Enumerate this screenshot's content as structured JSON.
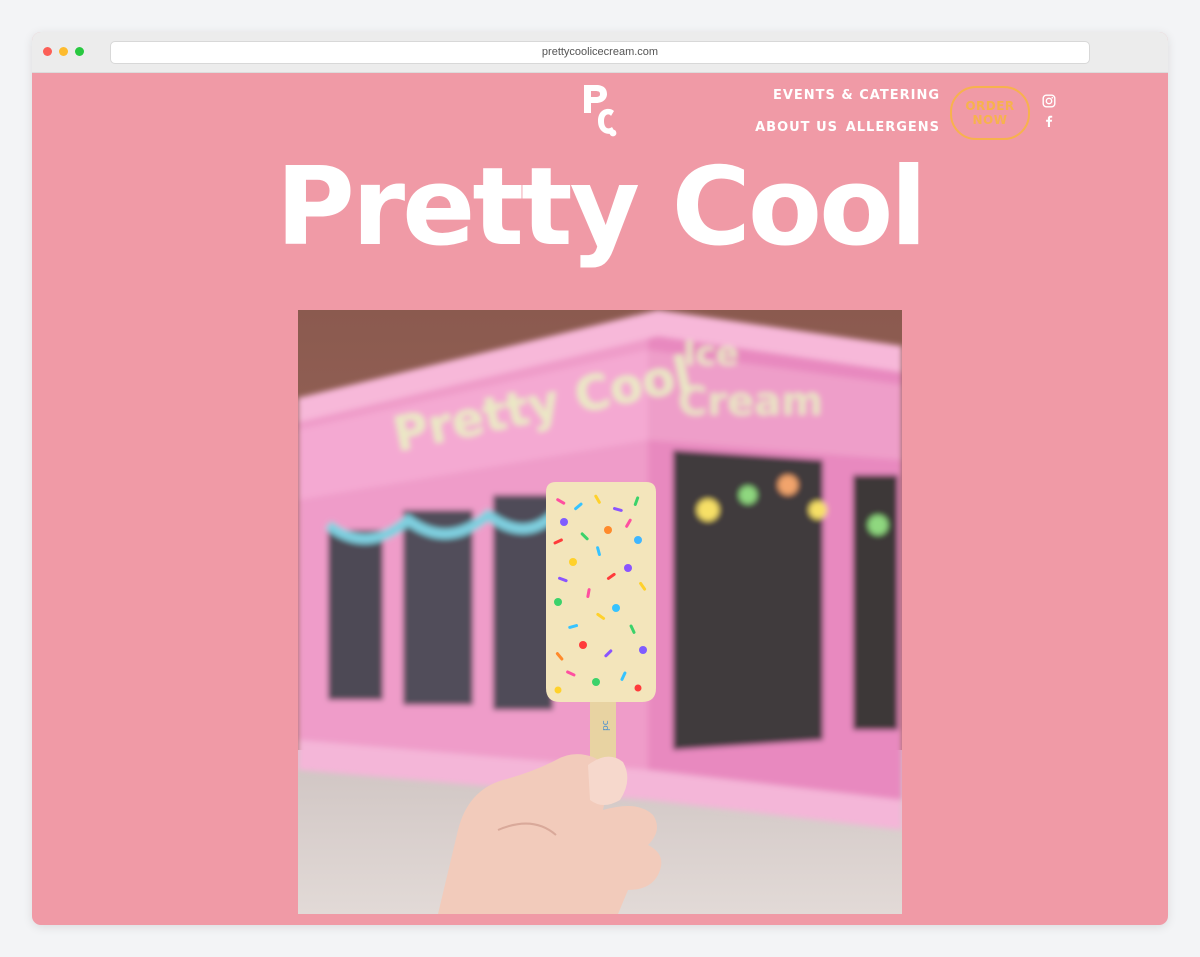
{
  "browser": {
    "url": "prettycoolicecream.com"
  },
  "nav": {
    "events_label": "EVENTS & CATERING",
    "about_label": "ABOUT US",
    "allergens_label": "ALLERGENS",
    "order_line1": "ORDER",
    "order_line2": "NOW",
    "social_icons": [
      "instagram-icon",
      "facebook-icon"
    ]
  },
  "logo": {
    "text": "PC"
  },
  "hero": {
    "title": "Pretty Cool",
    "storefront_sign": "Pretty Cool Ice Cream"
  },
  "colors": {
    "background": "#f09aa6",
    "text": "#ffffff",
    "order_button": "#f7b24d"
  }
}
